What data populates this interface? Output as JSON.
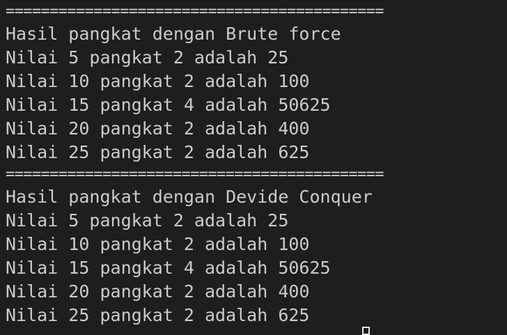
{
  "terminal": {
    "lines": [
      "===========================================",
      "Hasil pangkat dengan Brute force",
      "Nilai 5 pangkat 2 adalah 25",
      "Nilai 10 pangkat 2 adalah 100",
      "Nilai 15 pangkat 4 adalah 50625",
      "Nilai 20 pangkat 2 adalah 400",
      "Nilai 25 pangkat 2 adalah 625",
      "===========================================",
      "Hasil pangkat dengan Devide Conquer",
      "Nilai 5 pangkat 2 adalah 25",
      "Nilai 10 pangkat 2 adalah 100",
      "Nilai 15 pangkat 4 adalah 50625",
      "Nilai 20 pangkat 2 adalah 400",
      "Nilai 25 pangkat 2 adalah 625"
    ]
  },
  "colors": {
    "background": "#1e1e1e",
    "text": "#cccccc",
    "cursor": "#e6e6e6"
  }
}
